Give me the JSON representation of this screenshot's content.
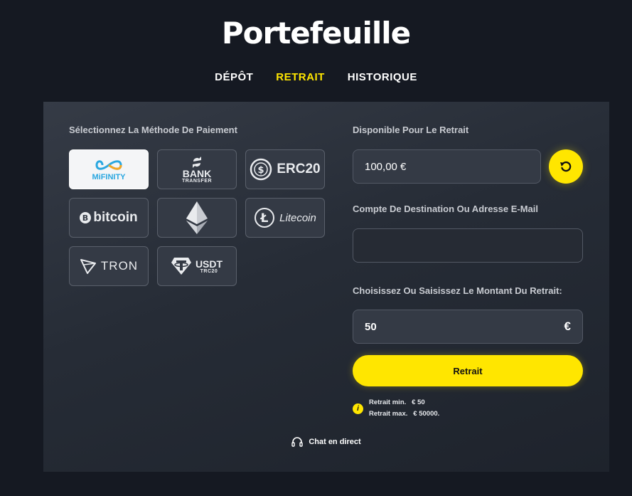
{
  "header": {
    "title": "Portefeuille"
  },
  "tabs": [
    {
      "label": "DÉPÔT",
      "active": false
    },
    {
      "label": "RETRAIT",
      "active": true
    },
    {
      "label": "HISTORIQUE",
      "active": false
    }
  ],
  "payment": {
    "label": "Sélectionnez La Méthode De Paiement",
    "methods": [
      {
        "id": "mifinity",
        "text": "MiFINITY",
        "selected": true,
        "icon": "infinity-icon"
      },
      {
        "id": "bank",
        "text": "BANK",
        "sub": "TRANSFER",
        "icon": "transfer-arrows-icon"
      },
      {
        "id": "erc20",
        "text": "ERC20",
        "icon": "dollar-circle-icon"
      },
      {
        "id": "bitcoin",
        "text": "bitcoin",
        "icon": "bitcoin-icon"
      },
      {
        "id": "ethereum",
        "icon": "ethereum-icon"
      },
      {
        "id": "litecoin",
        "text": "Litecoin",
        "icon": "litecoin-icon"
      },
      {
        "id": "tron",
        "text": "TRON",
        "icon": "tron-icon"
      },
      {
        "id": "usdt",
        "text": "USDT",
        "sub": "TRC20",
        "icon": "tether-icon"
      }
    ]
  },
  "available": {
    "label": "Disponible Pour Le Retrait",
    "value": "100,00 €"
  },
  "destination": {
    "label": "Compte De Destination Ou Adresse E-Mail",
    "value": ""
  },
  "amount": {
    "label": "Choisissez Ou Saisissez Le Montant Du Retrait:",
    "value": "50",
    "currency": "€"
  },
  "withdraw_button": "Retrait",
  "limits": {
    "min": "Retrait min.   € 50",
    "max": "Retrait max.   € 50000."
  },
  "chat": {
    "label": "Chat en direct"
  },
  "colors": {
    "accent": "#ffe600",
    "background": "#151922"
  }
}
